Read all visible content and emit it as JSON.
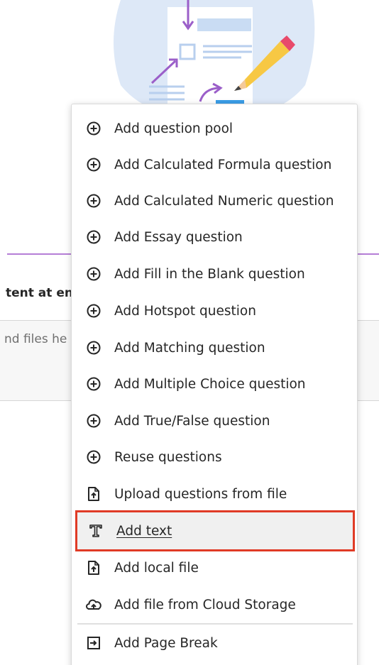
{
  "background": {
    "section_label": "tent at end",
    "drop_hint": "nd files he"
  },
  "menu": {
    "items": [
      {
        "label": "Add question pool",
        "icon": "plus-circle-icon"
      },
      {
        "label": "Add Calculated Formula question",
        "icon": "plus-circle-icon"
      },
      {
        "label": "Add Calculated Numeric question",
        "icon": "plus-circle-icon"
      },
      {
        "label": "Add Essay question",
        "icon": "plus-circle-icon"
      },
      {
        "label": "Add Fill in the Blank question",
        "icon": "plus-circle-icon"
      },
      {
        "label": "Add Hotspot question",
        "icon": "plus-circle-icon"
      },
      {
        "label": "Add Matching question",
        "icon": "plus-circle-icon"
      },
      {
        "label": "Add Multiple Choice question",
        "icon": "plus-circle-icon"
      },
      {
        "label": "Add True/False question",
        "icon": "plus-circle-icon"
      },
      {
        "label": "Reuse questions",
        "icon": "plus-circle-icon"
      },
      {
        "label": "Upload questions from file",
        "icon": "file-upload-icon"
      },
      {
        "label": "Add text",
        "icon": "text-icon",
        "selected": true
      },
      {
        "label": "Add local file",
        "icon": "file-upload-icon"
      },
      {
        "label": "Add file from Cloud Storage",
        "icon": "cloud-upload-icon"
      },
      {
        "label": "Add Page Break",
        "icon": "page-break-icon"
      }
    ]
  },
  "colors": {
    "accent_purple": "#b57ed6",
    "highlight_border": "#e03b26",
    "illustration_blue": "#dde8f7"
  }
}
